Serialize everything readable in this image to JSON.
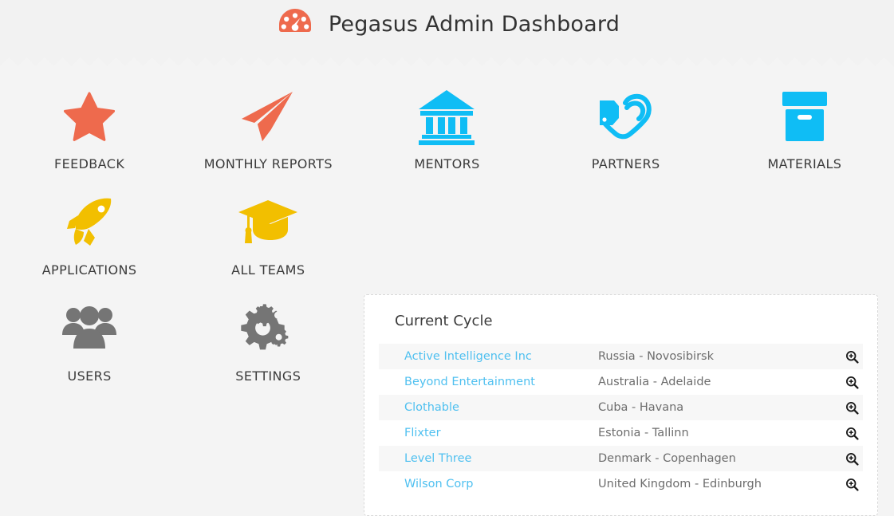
{
  "header": {
    "title": "Pegasus Admin Dashboard",
    "logo_icon": "speedometer-gauge-icon",
    "logo_color": "#ee6a4d",
    "background": "#f2f2f2"
  },
  "divider": {
    "icon": "zigzag-divider",
    "color": "#eaeaea"
  },
  "shortcuts": [
    {
      "label": "FEEDBACK",
      "icon": "star-icon",
      "color": "#ee6a4d"
    },
    {
      "label": "MONTHLY REPORTS",
      "icon": "paper-plane-icon",
      "color": "#ee6a4d"
    },
    {
      "label": "MENTORS",
      "icon": "bank-building-icon",
      "color": "#0fbdf5"
    },
    {
      "label": "PARTNERS",
      "icon": "handshake-icon",
      "color": "#0fbdf5"
    },
    {
      "label": "MATERIALS",
      "icon": "archive-box-icon",
      "color": "#0fbdf5"
    },
    {
      "label": "APPLICATIONS",
      "icon": "rocket-icon",
      "color": "#f2bf00"
    },
    {
      "label": "ALL TEAMS",
      "icon": "graduation-cap-icon",
      "color": "#f2bf00"
    },
    {
      "label": "",
      "icon": "",
      "color": ""
    },
    {
      "label": "",
      "icon": "",
      "color": ""
    },
    {
      "label": "",
      "icon": "",
      "color": ""
    },
    {
      "label": "USERS",
      "icon": "users-group-icon",
      "color": "#757575"
    },
    {
      "label": "SETTINGS",
      "icon": "gears-icon",
      "color": "#757575"
    }
  ],
  "current_cycle": {
    "title": "Current Cycle",
    "row_action_icon": "zoom-in-magnifier-icon",
    "link_color": "#4fc0f0",
    "rows": [
      {
        "company": "Active Intelligence Inc",
        "location": "Russia  -  Novosibirsk"
      },
      {
        "company": "Beyond Entertainment",
        "location": "Australia  -  Adelaide"
      },
      {
        "company": "Clothable",
        "location": "Cuba  -  Havana"
      },
      {
        "company": "Flixter",
        "location": "Estonia  -  Tallinn"
      },
      {
        "company": "Level Three",
        "location": "Denmark  -  Copenhagen"
      },
      {
        "company": "Wilson Corp",
        "location": "United Kingdom  -  Edinburgh"
      }
    ]
  }
}
